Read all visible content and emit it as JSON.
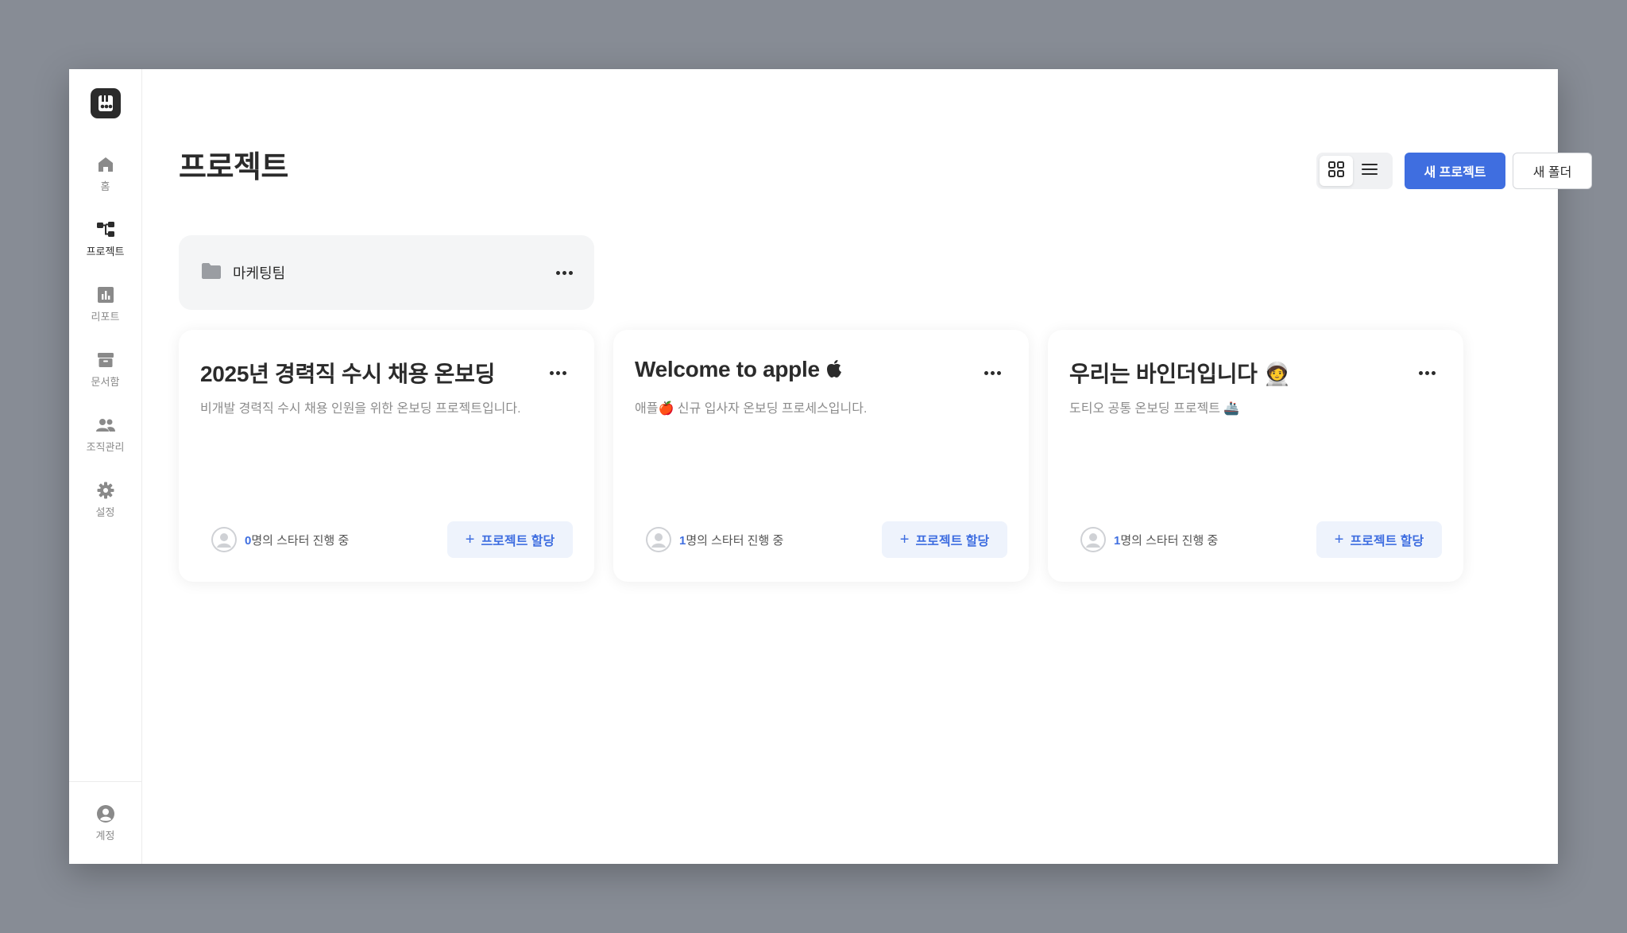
{
  "sidebar": {
    "logo": "binder-logo",
    "items": [
      {
        "label": "홈",
        "icon": "home-icon",
        "active": false
      },
      {
        "label": "프로젝트",
        "icon": "project-tree-icon",
        "active": true
      },
      {
        "label": "리포트",
        "icon": "report-chart-icon",
        "active": false
      },
      {
        "label": "문서함",
        "icon": "archive-box-icon",
        "active": false
      },
      {
        "label": "조직관리",
        "icon": "people-icon",
        "active": false
      },
      {
        "label": "설정",
        "icon": "gear-icon",
        "active": false
      }
    ],
    "account_label": "계정"
  },
  "header": {
    "title": "프로젝트",
    "new_project_label": "새 프로젝트",
    "new_folder_label": "새 폴더",
    "view_mode": "grid"
  },
  "folders": [
    {
      "name": "마케팅팀"
    }
  ],
  "projects": [
    {
      "title": "2025년 경력직 수시 채용 온보딩",
      "description": "비개발 경력직 수시 채용 인원을 위한 온보딩 프로젝트입니다.",
      "starter_count": "0",
      "starter_suffix": "명의 스타터 진행 중",
      "assign_label": "프로젝트 할당"
    },
    {
      "title": "Welcome to apple ",
      "description": "애플🍎 신규 입사자 온보딩 프로세스입니다.",
      "starter_count": "1",
      "starter_suffix": "명의 스타터 진행 중",
      "assign_label": "프로젝트 할당"
    },
    {
      "title": "우리는 바인더입니다 🧑‍🚀",
      "description": "도티오 공통 온보딩 프로젝트 🚢",
      "starter_count": "1",
      "starter_suffix": "명의 스타터 진행 중",
      "assign_label": "프로젝트 할당"
    }
  ],
  "colors": {
    "accent": "#3f6ee0",
    "background": "#878c95",
    "text": "#2b2b2b"
  }
}
